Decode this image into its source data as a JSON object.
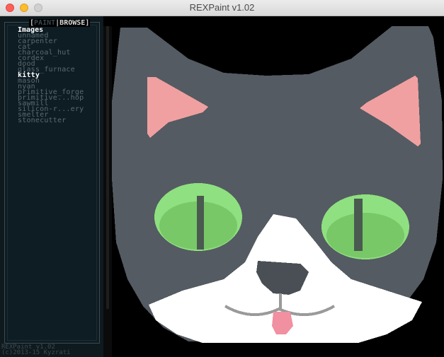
{
  "window": {
    "title": "REXPaint v1.02"
  },
  "tabs": {
    "paint": "PAINT",
    "separator": "|",
    "browse": "BROWSE"
  },
  "sidebar": {
    "section_title": "Images",
    "items": [
      {
        "label": "unnamed",
        "active": false
      },
      {
        "label": "carpenter",
        "active": false
      },
      {
        "label": "cat",
        "active": false
      },
      {
        "label": "charcoal_hut",
        "active": false
      },
      {
        "label": "cordex",
        "active": false
      },
      {
        "label": "dood",
        "active": false
      },
      {
        "label": "glass_furnace",
        "active": false
      },
      {
        "label": "kitty",
        "active": true
      },
      {
        "label": "mason",
        "active": false
      },
      {
        "label": "nyan",
        "active": false
      },
      {
        "label": "primitive_forge",
        "active": false
      },
      {
        "label": "primitive...hop",
        "active": false
      },
      {
        "label": "sawmill",
        "active": false
      },
      {
        "label": "silicon-r...ery",
        "active": false
      },
      {
        "label": "smelter",
        "active": false
      },
      {
        "label": "stonecutter",
        "active": false
      }
    ]
  },
  "footer": {
    "version": "REXPaint v1.02",
    "copyright": "(c)2013-15 Kyzrati"
  },
  "colors": {
    "fur": "#545b62",
    "ear_inner": "#f0a0a0",
    "eye": "#8fe080",
    "pupil": "#4a5a50",
    "muzzle": "#ffffff",
    "nose": "#4a4f55",
    "tongue": "#f090a0",
    "background": "#000000",
    "sidebar_bg": "#0e1c24",
    "item_text": "#5b6a70",
    "active_text": "#ffffff"
  }
}
